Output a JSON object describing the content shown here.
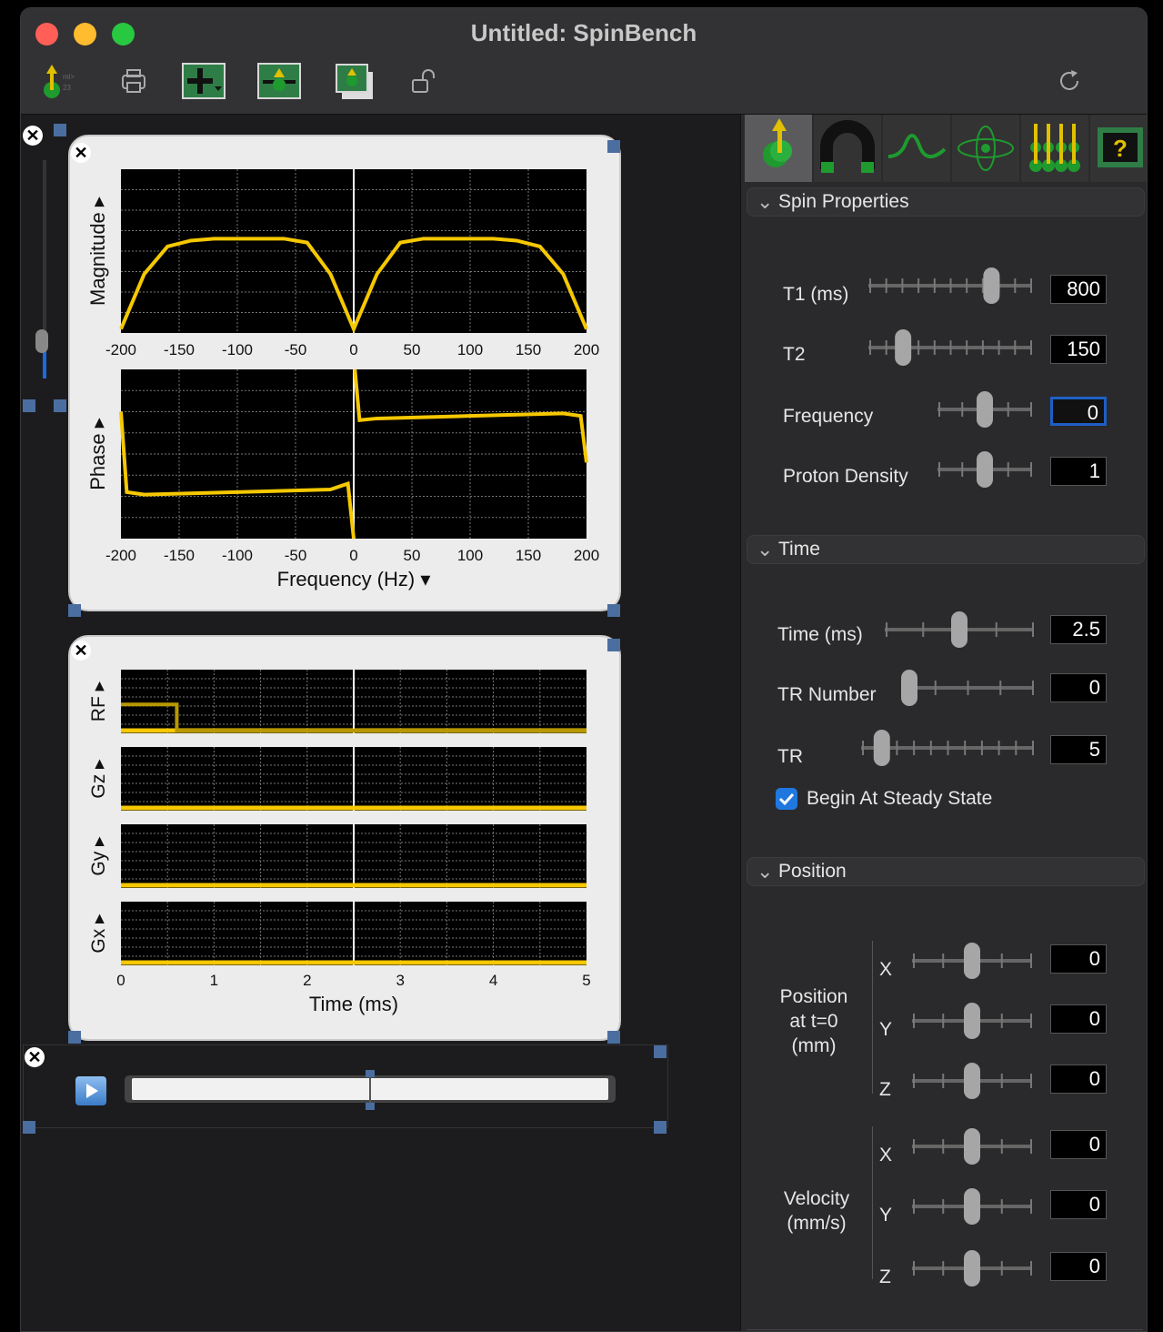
{
  "window": {
    "title": "Untitled: SpinBench"
  },
  "toolbar": {
    "icons": [
      "spin-logo-icon",
      "print-icon",
      "add-plot-icon",
      "spin-plot-icon",
      "layer-icon",
      "unlock-icon",
      "refresh-icon"
    ]
  },
  "freq_plot": {
    "mag_label": "Magnitude ▸",
    "phase_label": "Phase ▸",
    "xticks": [
      "-200",
      "-150",
      "-100",
      "-50",
      "0",
      "50",
      "100",
      "150",
      "200"
    ],
    "xlabel": "Frequency (Hz) ▾"
  },
  "seq_plot": {
    "channels": [
      "RF ▸",
      "Gz ▸",
      "Gy ▸",
      "Gx ▸"
    ],
    "xticks": [
      "0",
      "1",
      "2",
      "3",
      "4",
      "5"
    ],
    "xlabel": "Time (ms)"
  },
  "chart_data": [
    {
      "type": "line",
      "xlabel": "Frequency (Hz)",
      "ylabel": "Magnitude",
      "xlim": [
        -200,
        200
      ],
      "x": [
        -200,
        -180,
        -160,
        -140,
        -120,
        -100,
        -80,
        -60,
        -40,
        -20,
        0,
        20,
        40,
        60,
        80,
        100,
        120,
        140,
        160,
        180,
        200
      ],
      "values": [
        0.02,
        0.3,
        0.44,
        0.47,
        0.48,
        0.48,
        0.48,
        0.48,
        0.46,
        0.3,
        0.02,
        0.3,
        0.46,
        0.48,
        0.48,
        0.48,
        0.48,
        0.47,
        0.44,
        0.3,
        0.02
      ]
    },
    {
      "type": "line",
      "xlabel": "Frequency (Hz)",
      "ylabel": "Phase",
      "xlim": [
        -200,
        200
      ],
      "x": [
        -200,
        -195,
        -180,
        -100,
        -20,
        -5,
        0,
        1,
        5,
        20,
        100,
        180,
        195,
        200
      ],
      "values": [
        0.5,
        -0.45,
        -0.48,
        -0.45,
        -0.42,
        -0.35,
        -1.0,
        1.0,
        0.4,
        0.42,
        0.45,
        0.48,
        0.45,
        -0.1
      ]
    },
    {
      "type": "line",
      "xlabel": "Time (ms)",
      "ylabel": "RF",
      "xlim": [
        0,
        5
      ],
      "x": [
        0,
        0.6,
        0.6,
        5
      ],
      "values": [
        0.6,
        0.6,
        0,
        0
      ]
    }
  ],
  "playback": {
    "position": 0.5
  },
  "panel_tabs": [
    "spin-tab-icon",
    "magnet-tab-icon",
    "waveform-tab-icon",
    "atom-tab-icon",
    "spin-array-tab-icon",
    "help-tab-icon"
  ],
  "spin_props": {
    "header": "Spin Properties",
    "t1": {
      "label": "T1 (ms)",
      "value": "800",
      "level": 0.78
    },
    "t2": {
      "label": "T2",
      "value": "150",
      "level": 0.18
    },
    "freq": {
      "label": "Frequency",
      "value": "0",
      "level": 0.5
    },
    "pd": {
      "label": "Proton Density",
      "value": "1",
      "level": 0.5
    }
  },
  "time": {
    "header": "Time",
    "time_ms": {
      "label": "Time (ms)",
      "value": "2.5",
      "level": 0.5
    },
    "tr_number": {
      "label": "TR Number",
      "value": "0",
      "level": 0.0
    },
    "tr": {
      "label": "TR",
      "value": "5",
      "level": 0.08
    },
    "steady": {
      "label": "Begin At Steady State",
      "checked": true
    }
  },
  "position": {
    "header": "Position",
    "pos_label": "Position\nat t=0\n(mm)",
    "vel_label": "Velocity\n(mm/s)",
    "axes": [
      "X",
      "Y",
      "Z"
    ],
    "pos_values": [
      "0",
      "0",
      "0"
    ],
    "vel_values": [
      "0",
      "0",
      "0"
    ]
  },
  "colors": {
    "accent": "#f5c800",
    "plot_bg": "#000000",
    "window_bg": "#1c1c1e"
  }
}
